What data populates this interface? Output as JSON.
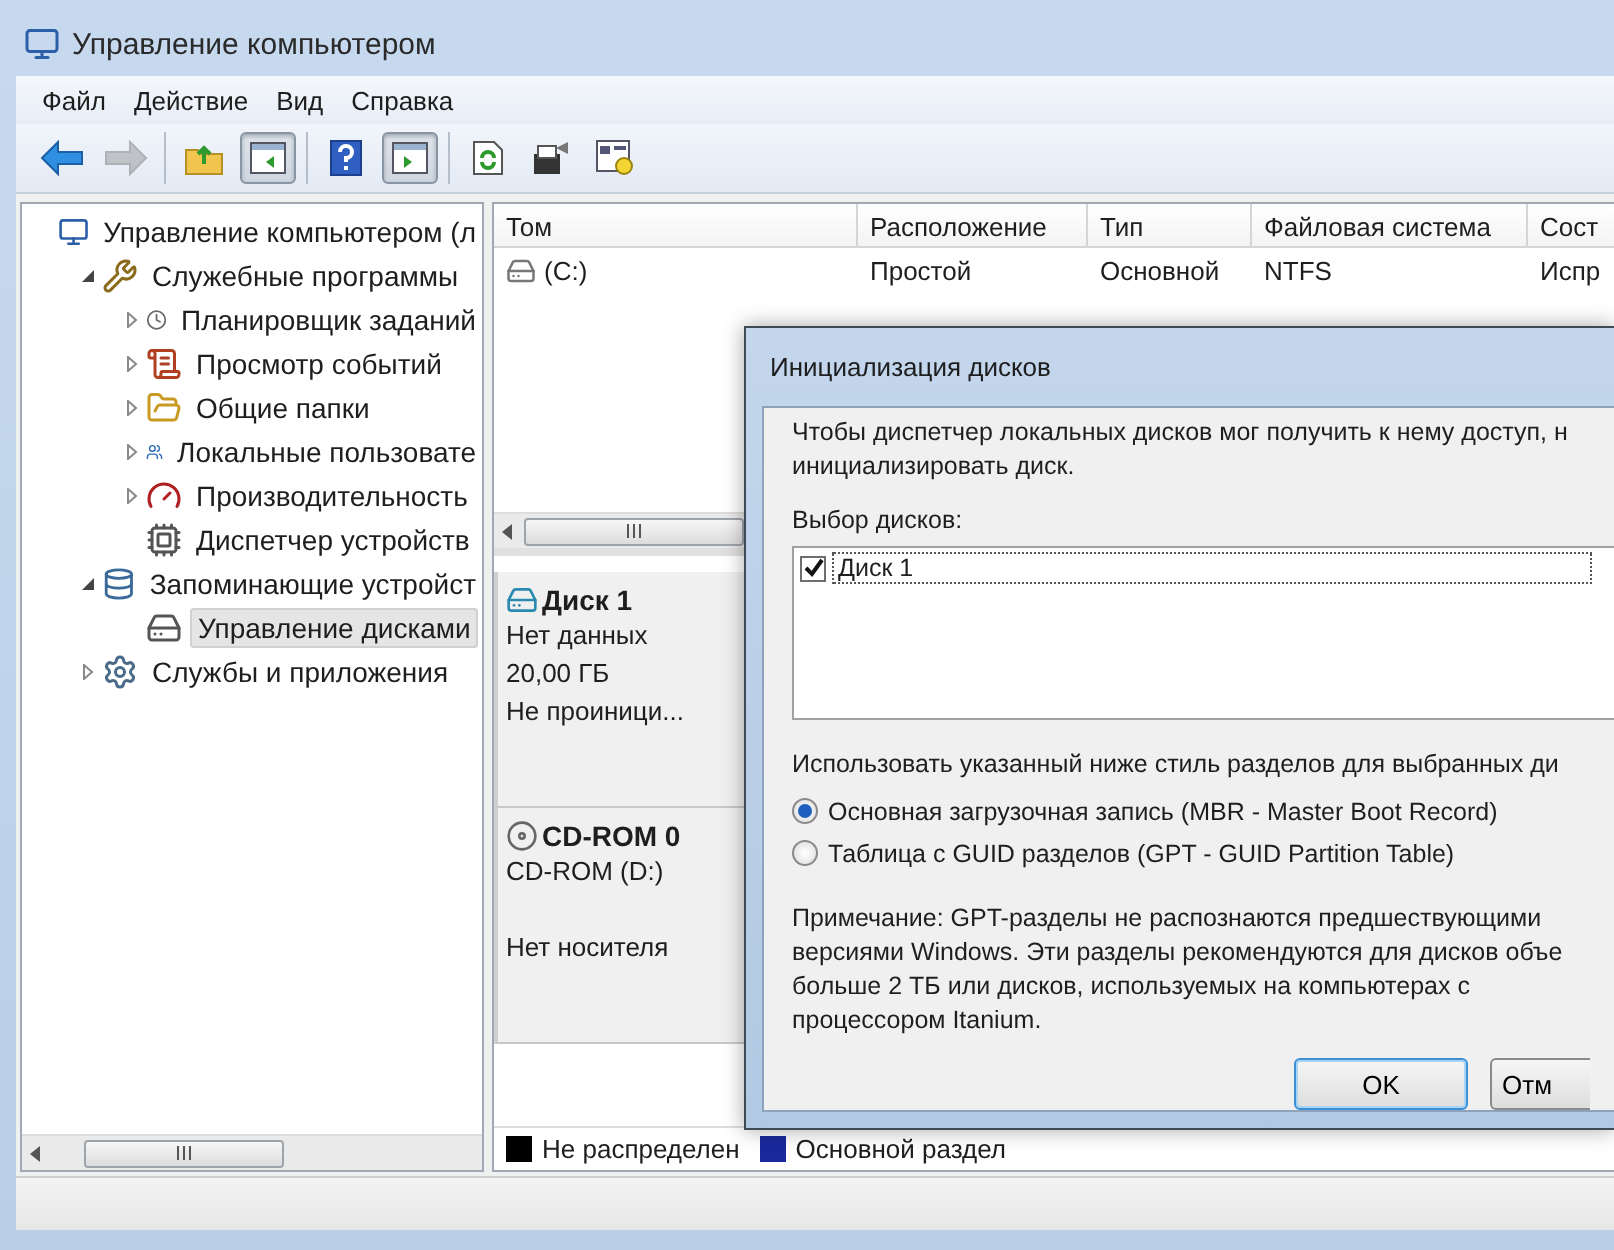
{
  "window": {
    "title": "Управление компьютером"
  },
  "menu": [
    "Файл",
    "Действие",
    "Вид",
    "Справка"
  ],
  "toolbar": [
    [
      {
        "kind": "back",
        "disabled": false,
        "pressed": false
      },
      {
        "kind": "forward",
        "disabled": true,
        "pressed": false
      }
    ],
    [
      {
        "kind": "up",
        "disabled": false,
        "pressed": false
      },
      {
        "kind": "console-tree",
        "disabled": false,
        "pressed": true
      }
    ],
    [
      {
        "kind": "help",
        "disabled": false,
        "pressed": false
      },
      {
        "kind": "action-pane",
        "disabled": false,
        "pressed": true
      }
    ],
    [
      {
        "kind": "refresh",
        "disabled": false,
        "pressed": false
      },
      {
        "kind": "export",
        "disabled": false,
        "pressed": false
      },
      {
        "kind": "properties",
        "disabled": false,
        "pressed": false
      }
    ]
  ],
  "tree": [
    {
      "label": "Управление компьютером (л",
      "kind": "computer",
      "selected": false,
      "children": [
        {
          "label": "Служебные программы",
          "kind": "tools",
          "expanded": true,
          "selected": false,
          "children": [
            {
              "label": "Планировщик заданий",
              "kind": "clock",
              "expanded": false,
              "selected": false
            },
            {
              "label": "Просмотр событий",
              "kind": "events",
              "expanded": false,
              "selected": false
            },
            {
              "label": "Общие папки",
              "kind": "folder",
              "expanded": false,
              "selected": false
            },
            {
              "label": "Локальные пользовате",
              "kind": "users",
              "expanded": false,
              "selected": false
            },
            {
              "label": "Производительность",
              "kind": "performance",
              "expanded": false,
              "selected": false
            },
            {
              "label": "Диспетчер устройств",
              "kind": "devices",
              "selected": false
            }
          ]
        },
        {
          "label": "Запоминающие устройст",
          "kind": "storage",
          "expanded": true,
          "selected": false,
          "children": [
            {
              "label": "Управление дисками",
              "kind": "disk",
              "selected": true
            }
          ]
        },
        {
          "label": "Службы и приложения",
          "kind": "services",
          "expanded": false,
          "selected": false
        }
      ]
    }
  ],
  "volumes": {
    "columns": [
      "Том",
      "Расположение",
      "Тип",
      "Файловая система",
      "Сост"
    ],
    "rows": [
      [
        "(C:)",
        "Простой",
        "Основной",
        "NTFS",
        "Испр"
      ]
    ]
  },
  "disks": [
    {
      "name": "Диск 1",
      "kind": "disk",
      "type": "Нет данных",
      "size": "20,00 ГБ",
      "status": "Не проиници..."
    },
    {
      "name": "CD-ROM 0",
      "kind": "cdrom",
      "type": "CD-ROM (D:)",
      "status": "Нет носителя"
    }
  ],
  "legend": [
    {
      "label": "Не распределен",
      "color": "#000000"
    },
    {
      "label": "Основной раздел",
      "color": "#1a2a9c"
    }
  ],
  "dialog": {
    "title": "Инициализация дисков",
    "intro": [
      "Чтобы диспетчер локальных дисков мог получить к нему доступ, н",
      "инициализировать диск."
    ],
    "list_label": "Выбор дисков:",
    "disks": [
      {
        "label": "Диск 1",
        "checked": true
      }
    ],
    "style_label": "Использовать указанный ниже стиль разделов для выбранных ди",
    "options": [
      {
        "label": "Основная загрузочная запись (MBR - Master Boot Record)",
        "selected": true
      },
      {
        "label": "Таблица с GUID разделов (GPT - GUID Partition Table)",
        "selected": false
      }
    ],
    "note": [
      "Примечание: GPT-разделы не распознаются предшествующими",
      "версиями Windows. Эти разделы рекомендуются для дисков объе",
      "больше 2 ТБ или дисков, используемых на компьютерах с",
      "процессором Itanium."
    ],
    "buttons": [
      {
        "label": "OK",
        "default": true
      },
      {
        "label": "Отм",
        "default": false
      }
    ]
  }
}
